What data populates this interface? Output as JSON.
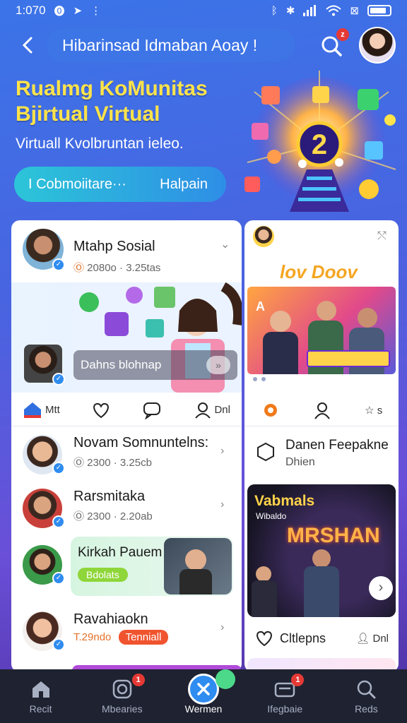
{
  "status": {
    "time": "1:070"
  },
  "header": {
    "title": "Hibarinsad Idmaban Aoay !"
  },
  "hero": {
    "title_line1": "Rualmg KoMunitas",
    "title_line2": "Bjirtual Virtual",
    "subtitle": "Virtuall Kvolbruntan ieleo.",
    "button_left": "I Cobmoiitare···",
    "button_right": "Halpain",
    "badge_number": "2"
  },
  "feed_left": {
    "post": {
      "name": "Mtahp Sosial",
      "meta": "2080o · 3.25tas",
      "banner_caption": "Dahns blohnap"
    },
    "actions": {
      "first_label": "Mtt",
      "last_label": "Dnl"
    },
    "items": [
      {
        "name": "Novam Somnuntelns:",
        "meta": "2300 · 3.25cb"
      },
      {
        "name": "Rarsmitaka",
        "meta": "2300 · 2.20ab"
      },
      {
        "name": "Kirkah Pauem",
        "tag": "Bdolats"
      },
      {
        "name": "Ravahiaokn",
        "meta": "T.29ndo",
        "tag": "Tenniall"
      }
    ]
  },
  "feed_right": {
    "top_title": "lov Doov",
    "banner_caption": "A",
    "item": {
      "name": "Danen Feepakne",
      "meta": "Dhien"
    },
    "promo": {
      "title": "Vabmals",
      "subtitle": "Wibaldo",
      "poster_title": "MRSHAN"
    },
    "bottom": {
      "label": "Cltlepns",
      "last_label": "Dnl"
    },
    "last_action_label": "s"
  },
  "nav": {
    "items": [
      {
        "label": "Recit",
        "icon": "home-icon"
      },
      {
        "label": "Mbearies",
        "icon": "instagram-icon",
        "badge": "1"
      },
      {
        "label": "Wermen",
        "icon": "x-icon"
      },
      {
        "label": "Ifegbaie",
        "icon": "wallet-icon",
        "badge": "1"
      },
      {
        "label": "Reds",
        "icon": "search-icon"
      }
    ],
    "active_index": 2
  },
  "colors": {
    "accent_yellow": "#ffe34a",
    "accent_blue": "#2f8cf0",
    "badge_red": "#e53935",
    "nav_bg": "#1f2230"
  }
}
